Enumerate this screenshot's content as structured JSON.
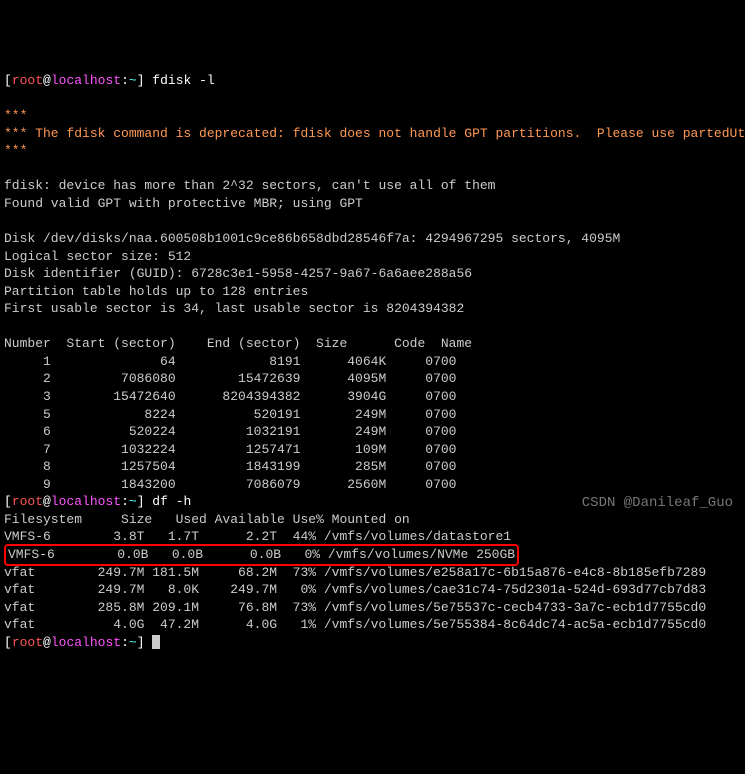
{
  "prompt": {
    "user": "root",
    "at": "@",
    "host": "localhost",
    "path": "~",
    "end": "]"
  },
  "cmd1": " fdisk -l",
  "cmd2": " df -h",
  "warn_line1": "***",
  "warn_line2_a": "*** The fdisk command is deprecated",
  "warn_line2_b": ": fdisk does not handle GPT partitions.  Please use partedUtil",
  "warn_line3": "***",
  "blank": "",
  "msg1": "fdisk: device has more than 2^32 sectors, can't use all of them",
  "msg2": "Found valid GPT with protective MBR; using GPT",
  "disk1": "Disk /dev/disks/naa.600508b1001c9ce86b658dbd28546f7a: 4294967295 sectors, 4095M",
  "disk2": "Logical sector size: 512",
  "disk3": "Disk identifier (GUID): 6728c3e1-5958-4257-9a67-6a6aee288a56",
  "disk4": "Partition table holds up to 128 entries",
  "disk5": "First usable sector is 34, last usable sector is 8204394382",
  "part_header": "Number  Start (sector)    End (sector)  Size      Code  Name",
  "partitions": [
    "     1              64            8191      4064K     0700",
    "     2         7086080        15472639      4095M     0700",
    "     3        15472640      8204394382      3904G     0700",
    "     5            8224          520191       249M     0700",
    "     6          520224         1032191       249M     0700",
    "     7         1032224         1257471       109M     0700",
    "     8         1257504         1843199       285M     0700",
    "     9         1843200         7086079      2560M     0700"
  ],
  "df_header": "Filesystem     Size   Used Available Use% Mounted on",
  "df_rows": [
    "VMFS-6        3.8T   1.7T      2.2T  44% /vmfs/volumes/datastore1",
    "VMFS-6        0.0B   0.0B      0.0B   0% /vmfs/volumes/NVMe 250GB",
    "vfat        249.7M 181.5M     68.2M  73% /vmfs/volumes/e258a17c-6b15a876-e4c8-8b185efb7289",
    "vfat        249.7M   8.0K    249.7M   0% /vmfs/volumes/cae31c74-75d2301a-524d-693d77cb7d83",
    "vfat        285.8M 209.1M     76.8M  73% /vmfs/volumes/5e75537c-cecb4733-3a7c-ecb1d7755cd0",
    "vfat          4.0G  47.2M      4.0G   1% /vmfs/volumes/5e755384-8c64dc74-ac5a-ecb1d7755cd0"
  ],
  "watermark": "CSDN @Danileaf_Guo"
}
